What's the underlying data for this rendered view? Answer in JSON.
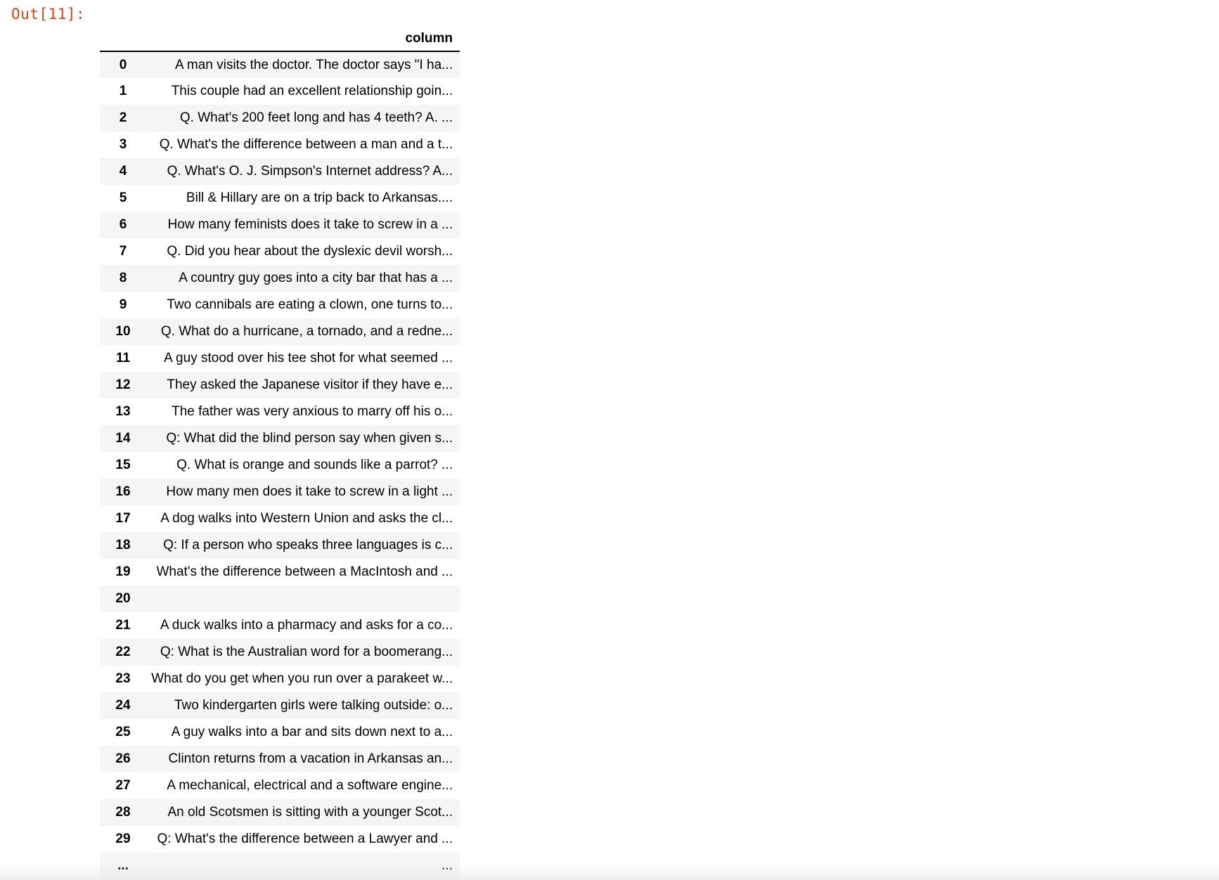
{
  "output": {
    "prompt_label": "Out[11]:"
  },
  "dataframe": {
    "columns": [
      "",
      "column"
    ],
    "rows": [
      {
        "index": "0",
        "value": "A man visits the doctor. The doctor says \"I ha..."
      },
      {
        "index": "1",
        "value": "This couple had an excellent relationship goin..."
      },
      {
        "index": "2",
        "value": "Q. What's 200 feet long and has 4 teeth? A. ..."
      },
      {
        "index": "3",
        "value": "Q. What's the difference between a man and a t..."
      },
      {
        "index": "4",
        "value": "Q. What's O. J. Simpson's Internet address? A..."
      },
      {
        "index": "5",
        "value": "Bill & Hillary are on a trip back to Arkansas...."
      },
      {
        "index": "6",
        "value": "How many feminists does it take to screw in a ..."
      },
      {
        "index": "7",
        "value": "Q. Did you hear about the dyslexic devil worsh..."
      },
      {
        "index": "8",
        "value": "A country guy goes into a city bar that has a ..."
      },
      {
        "index": "9",
        "value": "Two cannibals are eating a clown, one turns to..."
      },
      {
        "index": "10",
        "value": "Q. What do a hurricane, a tornado, and a redne..."
      },
      {
        "index": "11",
        "value": "A guy stood over his tee shot for what seemed ..."
      },
      {
        "index": "12",
        "value": "They asked the Japanese visitor if they have e..."
      },
      {
        "index": "13",
        "value": "The father was very anxious to marry off his o..."
      },
      {
        "index": "14",
        "value": "Q: What did the blind person say when given s..."
      },
      {
        "index": "15",
        "value": "Q. What is orange and sounds like a parrot? ..."
      },
      {
        "index": "16",
        "value": "How many men does it take to screw in a light ..."
      },
      {
        "index": "17",
        "value": "A dog walks into Western Union and asks the cl..."
      },
      {
        "index": "18",
        "value": "Q: If a person who speaks three languages is c..."
      },
      {
        "index": "19",
        "value": "What's the difference between a MacIntosh and ..."
      },
      {
        "index": "20",
        "value": ""
      },
      {
        "index": "21",
        "value": "A duck walks into a pharmacy and asks for a co..."
      },
      {
        "index": "22",
        "value": "Q: What is the Australian word for a boomerang..."
      },
      {
        "index": "23",
        "value": "What do you get when you run over a parakeet w..."
      },
      {
        "index": "24",
        "value": "Two kindergarten girls were talking outside: o..."
      },
      {
        "index": "25",
        "value": "A guy walks into a bar and sits down next to a..."
      },
      {
        "index": "26",
        "value": "Clinton returns from a vacation in Arkansas an..."
      },
      {
        "index": "27",
        "value": "A mechanical, electrical and a software engine..."
      },
      {
        "index": "28",
        "value": "An old Scotsmen is sitting with a younger Scot..."
      },
      {
        "index": "29",
        "value": "Q: What's the difference between a Lawyer and ..."
      },
      {
        "index": "...",
        "value": "..."
      }
    ]
  }
}
